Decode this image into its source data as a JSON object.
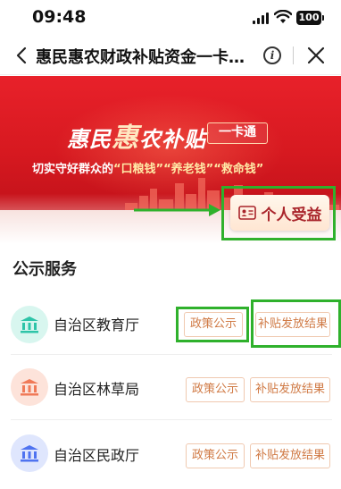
{
  "status_bar": {
    "time": "09:48",
    "battery": "100",
    "icons": [
      "signal-icon",
      "wifi-icon",
      "battery-icon"
    ]
  },
  "nav": {
    "title": "惠民惠农财政补贴资金一卡…",
    "icons": [
      "back-arrow-icon",
      "info-icon",
      "close-icon"
    ]
  },
  "banner": {
    "title_part1": "惠民",
    "title_big": "惠",
    "title_part2": "农补贴",
    "tag": "一卡通",
    "slogan_prefix": "切实守好群众的",
    "slogan_item1": "“口粮钱”",
    "slogan_item2": "“养老钱”",
    "slogan_item3": "“救命钱”",
    "benefit_button": "个人受益"
  },
  "section": {
    "title": "公示服务"
  },
  "services": [
    {
      "name": "自治区教育厅",
      "policy": "政策公示",
      "result": "补贴发放结果",
      "icon_color": "#2ec4a8",
      "icon_bg": "#d8f6ef"
    },
    {
      "name": "自治区林草局",
      "policy": "政策公示",
      "result": "补贴发放结果",
      "icon_color": "#f07a58",
      "icon_bg": "#fde3da"
    },
    {
      "name": "自治区民政厅",
      "policy": "政策公示",
      "result": "补贴发放结果",
      "icon_color": "#4f73f0",
      "icon_bg": "#dfe6fd"
    }
  ],
  "colors": {
    "banner_red": "#d71920",
    "highlight_green": "#2fb12c",
    "tag_text": "#d07a45"
  }
}
